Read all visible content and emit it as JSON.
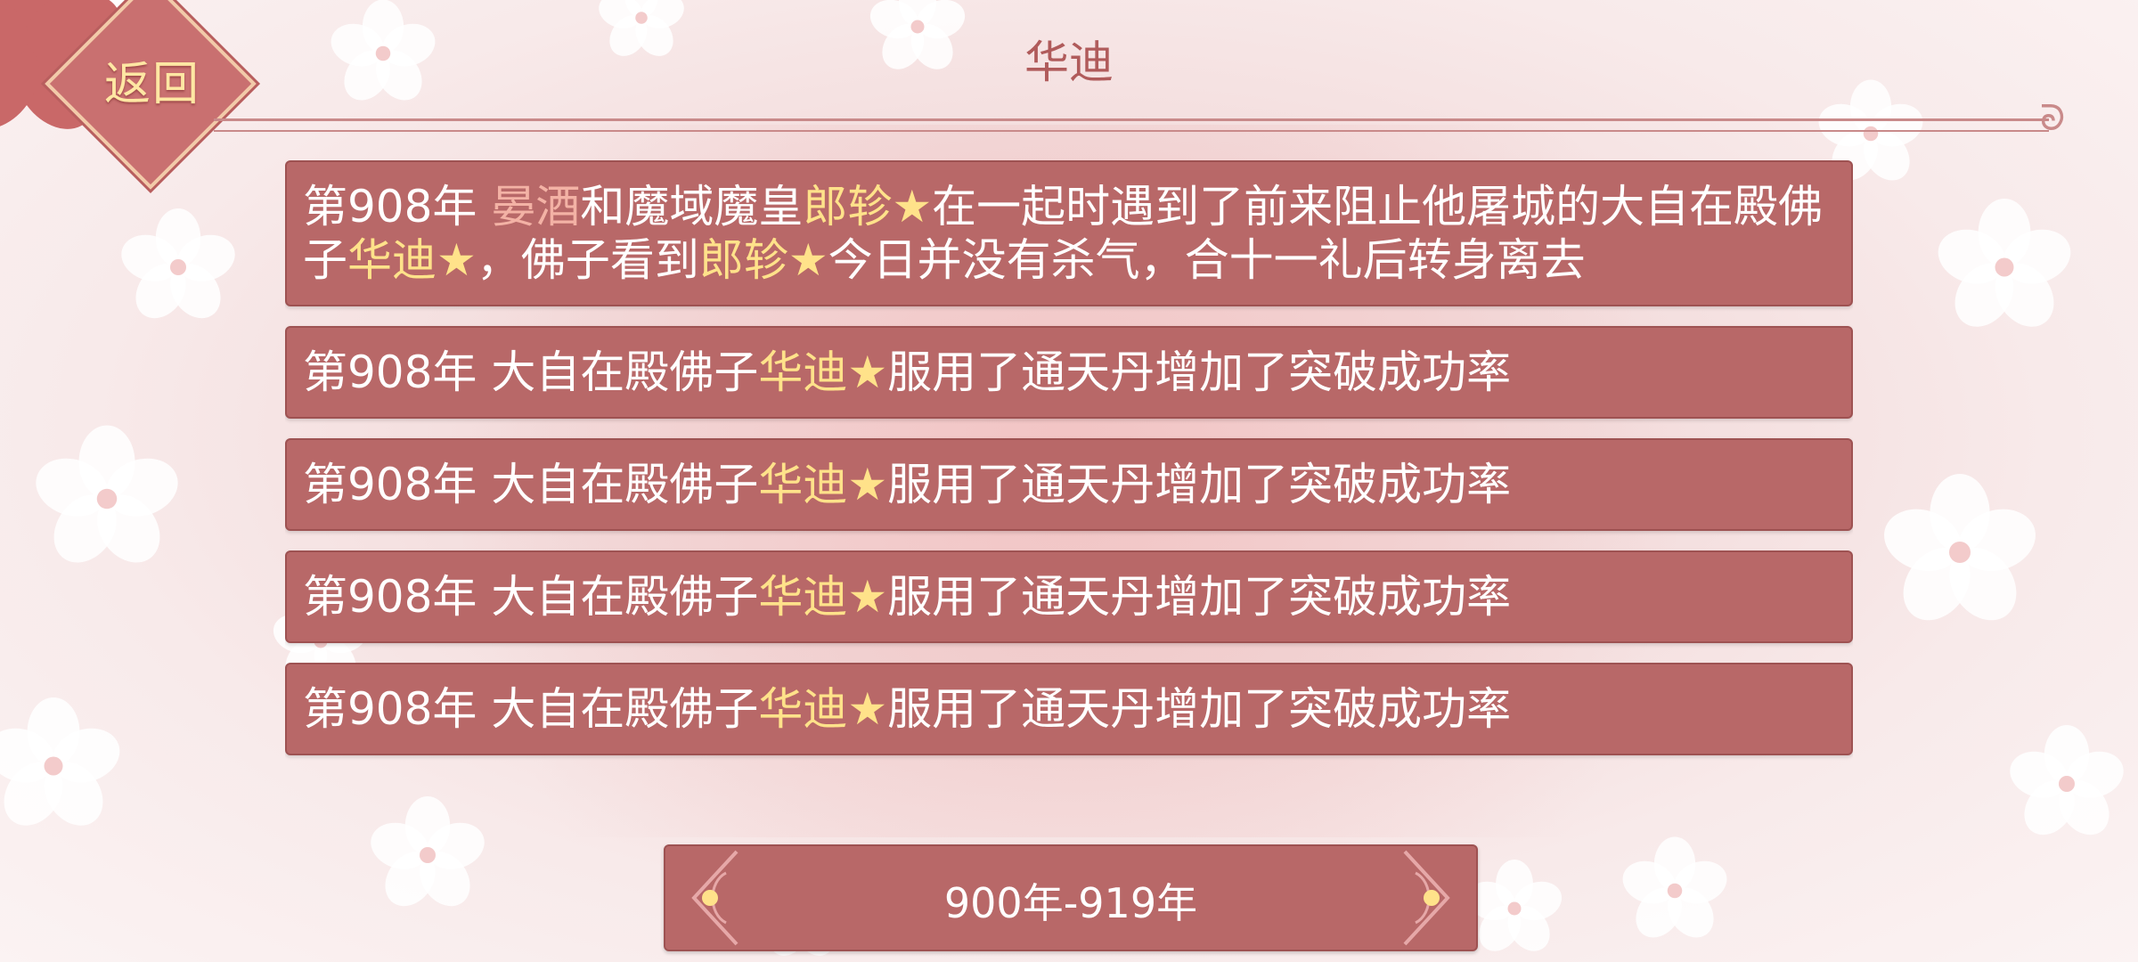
{
  "header": {
    "back_label": "返回",
    "title": "华迪"
  },
  "events": [
    {
      "segments": [
        {
          "text": "第908年 ",
          "style": "plain"
        },
        {
          "text": "晏酒",
          "style": "rose"
        },
        {
          "text": "和魔域魔皇",
          "style": "plain"
        },
        {
          "text": "郎轸",
          "style": "gold"
        },
        {
          "text": "★",
          "style": "star"
        },
        {
          "text": "在一起时遇到了前来阻止他屠城的大自在殿佛子",
          "style": "plain"
        },
        {
          "text": "华迪",
          "style": "gold"
        },
        {
          "text": "★",
          "style": "star"
        },
        {
          "text": "，佛子看到",
          "style": "plain"
        },
        {
          "text": "郎轸",
          "style": "gold"
        },
        {
          "text": "★",
          "style": "star"
        },
        {
          "text": "今日并没有杀气，合十一礼后转身离去",
          "style": "plain"
        }
      ]
    },
    {
      "segments": [
        {
          "text": "第908年 大自在殿佛子",
          "style": "plain"
        },
        {
          "text": "华迪",
          "style": "gold"
        },
        {
          "text": "★",
          "style": "star"
        },
        {
          "text": "服用了通天丹增加了突破成功率",
          "style": "plain"
        }
      ]
    },
    {
      "segments": [
        {
          "text": "第908年 大自在殿佛子",
          "style": "plain"
        },
        {
          "text": "华迪",
          "style": "gold"
        },
        {
          "text": "★",
          "style": "star"
        },
        {
          "text": "服用了通天丹增加了突破成功率",
          "style": "plain"
        }
      ]
    },
    {
      "segments": [
        {
          "text": "第908年 大自在殿佛子",
          "style": "plain"
        },
        {
          "text": "华迪",
          "style": "gold"
        },
        {
          "text": "★",
          "style": "star"
        },
        {
          "text": "服用了通天丹增加了突破成功率",
          "style": "plain"
        }
      ]
    },
    {
      "segments": [
        {
          "text": "第908年 大自在殿佛子",
          "style": "plain"
        },
        {
          "text": "华迪",
          "style": "gold"
        },
        {
          "text": "★",
          "style": "star"
        },
        {
          "text": "服用了通天丹增加了突破成功率",
          "style": "plain"
        }
      ]
    }
  ],
  "pager": {
    "range_label": "900年-919年",
    "prev_icon": "ornate-left-arrow-icon",
    "next_icon": "ornate-right-arrow-icon"
  },
  "colors": {
    "card_bg": "#b86868",
    "highlight_gold": "#ffe28a",
    "highlight_rose": "#f3b2a5",
    "title": "#b05b5b",
    "back_text": "#ffe7a3"
  }
}
